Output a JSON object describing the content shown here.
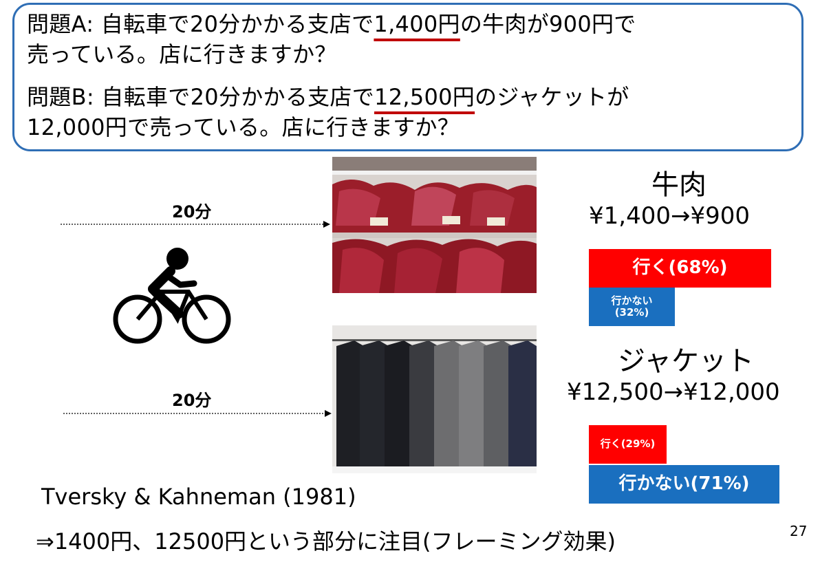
{
  "problems": {
    "a": {
      "line1_pre": "問題A: 自転車で20分かかる支店で",
      "line1_underlined": "1,400円",
      "line1_post": "の牛肉が900円で",
      "line2": "売っている。店に行きますか？"
    },
    "b": {
      "line1_pre": "問題B: 自転車で20分かかる支店で",
      "line1_underlined": "12,500円",
      "line1_post": "のジャケットが",
      "line2": "12,000円で売っている。店に行きますか？"
    }
  },
  "travel": {
    "time_top": "20分",
    "time_bottom": "20分"
  },
  "items": {
    "beef": {
      "title": "牛肉",
      "price": "¥1,400→¥900",
      "go_label": "行く(68%)",
      "go_percent": 68,
      "nogo_label_line1": "行かない",
      "nogo_label_line2": "(32%)",
      "nogo_percent": 32
    },
    "jacket": {
      "title": "ジャケット",
      "price": "¥12,500→¥12,000",
      "go_label": "行く(29%)",
      "go_percent": 29,
      "nogo_label": "行かない(71%)",
      "nogo_percent": 71
    }
  },
  "citation": "Tversky & Kahneman (1981)",
  "conclusion": "⇒1400円、12500円という部分に注目(フレーミング効果)",
  "page_number": "27",
  "colors": {
    "box_border": "#2f6eb5",
    "underline": "#c00000",
    "go_bar": "#ff0000",
    "nogo_bar": "#1a6fbf"
  }
}
